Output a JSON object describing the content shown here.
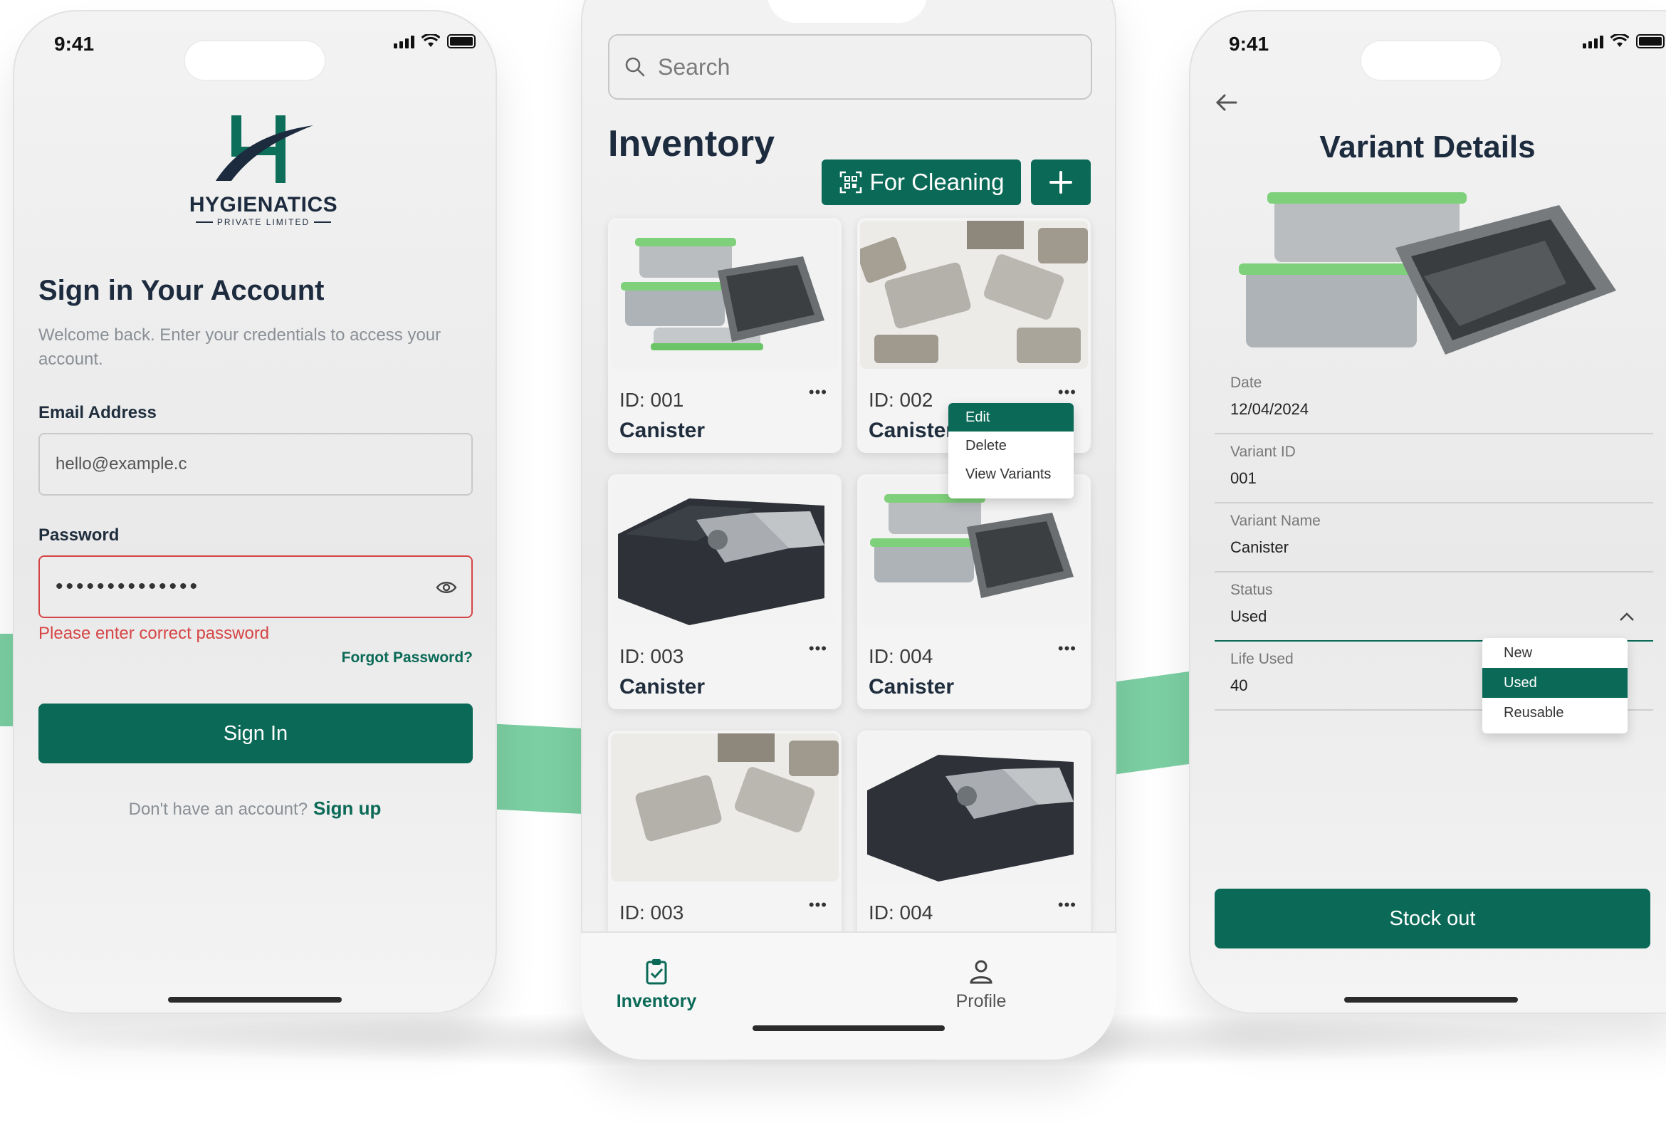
{
  "status_bar": {
    "time": "9:41"
  },
  "signin": {
    "brand_name": "HYGIENATICS",
    "brand_sub": "PRIVATE LIMITED",
    "title": "Sign in Your Account",
    "subtitle": "Welcome back. Enter your credentials to access your account.",
    "email_label": "Email Address",
    "email_value": "hello@example.c",
    "password_label": "Password",
    "password_value": "••••••••••••••",
    "error_text": "Please enter correct password",
    "forgot_label": "Forgot Password?",
    "signin_label": "Sign In",
    "no_account_text": "Don't have an account?",
    "signup_label": "Sign up"
  },
  "inventory": {
    "search_placeholder": "Search",
    "title": "Inventory",
    "for_cleaning_label": "For Cleaning",
    "cards": [
      {
        "id": "ID: 001",
        "name": "Canister"
      },
      {
        "id": "ID: 002",
        "name": "Canister"
      },
      {
        "id": "ID: 003",
        "name": "Canister"
      },
      {
        "id": "ID: 004",
        "name": "Canister"
      },
      {
        "id": "ID: 003",
        "name": ""
      },
      {
        "id": "ID: 004",
        "name": ""
      }
    ],
    "more_glyph": "•••",
    "context_menu": {
      "edit": "Edit",
      "delete": "Delete",
      "view_variants": "View Variants"
    },
    "nav": {
      "inventory": "Inventory",
      "profile": "Profile"
    }
  },
  "variant": {
    "title": "Variant Details",
    "fields": [
      {
        "label": "Date",
        "value": "12/04/2024"
      },
      {
        "label": "Variant ID",
        "value": "001"
      },
      {
        "label": "Variant Name",
        "value": "Canister"
      },
      {
        "label": "Status",
        "value": "Used"
      },
      {
        "label": "Life Used",
        "value": "40"
      }
    ],
    "status_options": [
      "New",
      "Used",
      "Reusable"
    ],
    "stock_out_label": "Stock out"
  },
  "colors": {
    "primary": "#0b6a57",
    "error": "#d64545",
    "accent_ribbon": "#7ccfa3"
  },
  "icons": [
    "search-icon",
    "qr-scan-icon",
    "plus-icon",
    "more-icon",
    "eye-icon",
    "back-arrow-icon",
    "chevron-up-icon",
    "clipboard-check-icon",
    "user-icon"
  ]
}
